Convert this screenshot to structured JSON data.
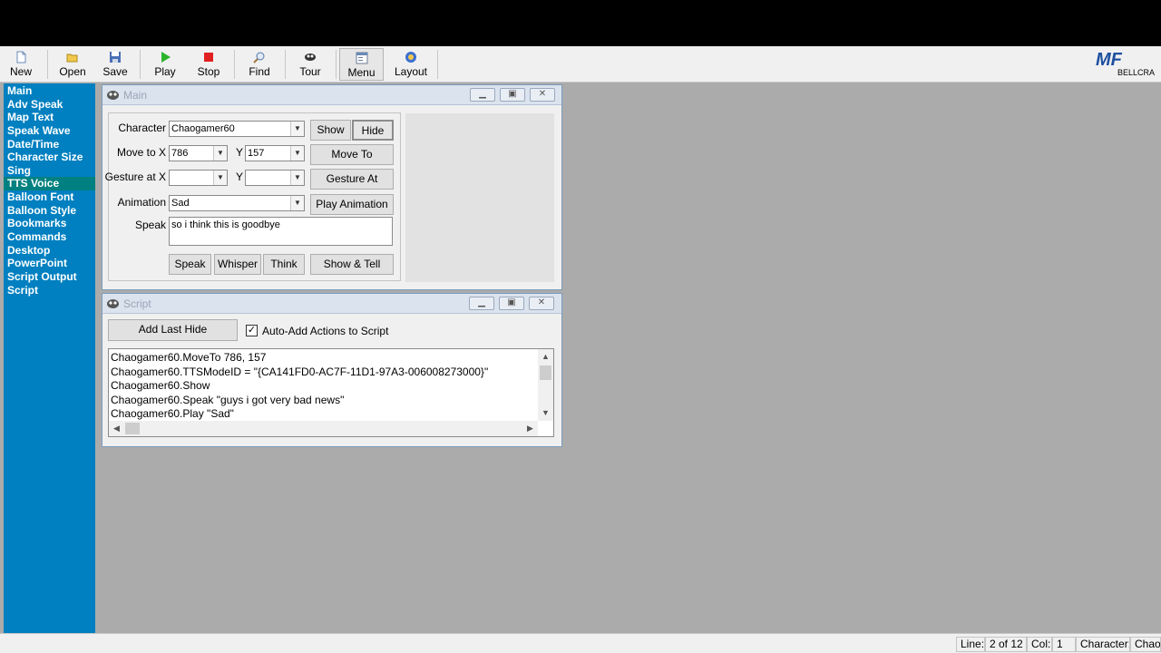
{
  "toolbar": {
    "buttons": [
      {
        "label": "New",
        "icon": "new-document-icon"
      },
      {
        "label": "Open",
        "icon": "open-folder-icon"
      },
      {
        "label": "Save",
        "icon": "save-disk-icon"
      },
      {
        "label": "Play",
        "icon": "play-icon"
      },
      {
        "label": "Stop",
        "icon": "stop-icon"
      },
      {
        "label": "Find",
        "icon": "find-icon"
      },
      {
        "label": "Tour",
        "icon": "tour-icon"
      },
      {
        "label": "Menu",
        "icon": "menu-icon"
      },
      {
        "label": "Layout",
        "icon": "layout-icon"
      }
    ],
    "logo_mark": "MF",
    "logo_text": "BELLCRA"
  },
  "sidebar": {
    "items": [
      {
        "label": "Main"
      },
      {
        "label": "Adv Speak"
      },
      {
        "label": "Map Text"
      },
      {
        "label": "Speak Wave"
      },
      {
        "label": "Date/Time"
      },
      {
        "label": "Character Size"
      },
      {
        "label": "Sing"
      },
      {
        "label": "TTS Voice"
      },
      {
        "label": "Balloon Font"
      },
      {
        "label": "Balloon Style"
      },
      {
        "label": "Bookmarks"
      },
      {
        "label": "Commands"
      },
      {
        "label": "Desktop"
      },
      {
        "label": "PowerPoint"
      },
      {
        "label": "Script Output"
      },
      {
        "label": "Script"
      }
    ],
    "active": "TTS Voice"
  },
  "main_window": {
    "title": "Main",
    "character_label": "Character",
    "character_value": "Chaogamer60",
    "show_label": "Show",
    "hide_label": "Hide",
    "move_to_x_label": "Move to X",
    "move_x_value": "786",
    "y_label": "Y",
    "move_y_value": "157",
    "move_to_label": "Move To",
    "gesture_at_x_label": "Gesture at X",
    "gesture_x_value": "",
    "gesture_y_value": "",
    "gesture_at_label": "Gesture At",
    "animation_label": "Animation",
    "animation_value": "Sad",
    "play_animation_label": "Play Animation",
    "speak_label": "Speak",
    "speak_text": "so i think this is goodbye",
    "speak_button": "Speak",
    "whisper_button": "Whisper",
    "think_button": "Think",
    "show_tell_button": "Show & Tell"
  },
  "script_window": {
    "title": "Script",
    "add_last_label": "Add Last Hide",
    "auto_add_label": "Auto-Add Actions to Script",
    "auto_add_checked": true,
    "lines": [
      "Chaogamer60.MoveTo 786, 157",
      "Chaogamer60.TTSModeID = \"{CA141FD0-AC7F-11D1-97A3-006008273000}\"",
      "Chaogamer60.Show",
      "Chaogamer60.Speak \"guys i got very bad news\"",
      "Chaogamer60.Play \"Sad\""
    ]
  },
  "statusbar": {
    "line_label": "Line:",
    "line_value": "2 of 12",
    "col_label": "Col:",
    "col_value": "1",
    "character_label": "Character:",
    "character_value": "Chaog"
  },
  "colors": {
    "sidebar_bg": "#0080c0",
    "sidebar_active": "#008080",
    "workspace": "#ababab"
  }
}
